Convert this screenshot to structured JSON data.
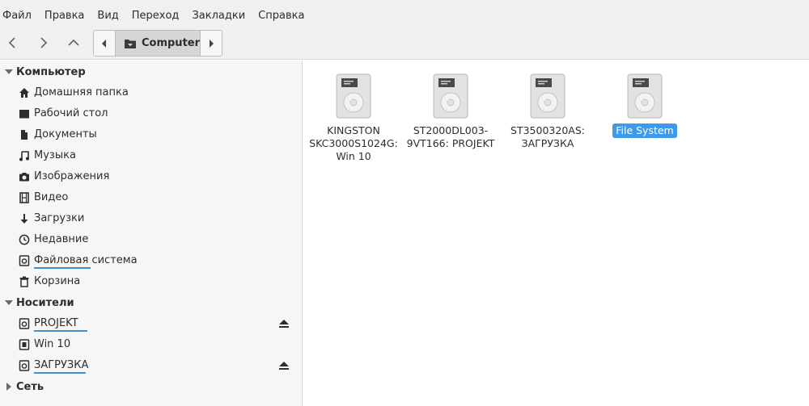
{
  "menu": [
    "Файл",
    "Правка",
    "Вид",
    "Переход",
    "Закладки",
    "Справка"
  ],
  "toolbar": {
    "back_icon": "chevron-left-icon",
    "forward_icon": "chevron-right-icon",
    "up_icon": "chevron-up-icon",
    "path": {
      "crumb_label": "Computer",
      "crumb_icon": "computer-folder-icon"
    }
  },
  "sidebar": {
    "computer_section": "Компьютер",
    "computer_items": [
      {
        "label": "Домашняя папка",
        "icon": "home-icon"
      },
      {
        "label": "Рабочий стол",
        "icon": "desktop-icon"
      },
      {
        "label": "Документы",
        "icon": "document-icon"
      },
      {
        "label": "Музыка",
        "icon": "music-icon"
      },
      {
        "label": "Изображения",
        "icon": "camera-icon"
      },
      {
        "label": "Видео",
        "icon": "film-icon"
      },
      {
        "label": "Загрузки",
        "icon": "download-icon"
      },
      {
        "label": "Недавние",
        "icon": "clock-icon"
      },
      {
        "label": "Файловая система",
        "icon": "drive-icon"
      },
      {
        "label": "Корзина",
        "icon": "trash-icon"
      }
    ],
    "devices_section": "Носители",
    "device_items": [
      {
        "label": "PROJEKT",
        "icon": "drive-icon",
        "eject": true
      },
      {
        "label": "Win 10",
        "icon": "chip-drive-icon",
        "eject": false
      },
      {
        "label": "ЗАГРУЗКА",
        "icon": "drive-icon",
        "eject": true
      }
    ],
    "network_section": "Сеть"
  },
  "content": {
    "drives": [
      {
        "name": "KINGSTON SKC3000S1024G: Win 10",
        "selected": false
      },
      {
        "name": "ST2000DL003-9VT166: PROJEKT",
        "selected": false
      },
      {
        "name": "ST3500320AS: ЗАГРУЗКА",
        "selected": false
      },
      {
        "name": "File System",
        "selected": true
      }
    ]
  },
  "colors": {
    "selection": "#3d9ae8",
    "usage_bar": "#3d8fd1",
    "sidebar_bg": "#f6f6f6",
    "toolbar_bg": "#f0f0f0"
  }
}
